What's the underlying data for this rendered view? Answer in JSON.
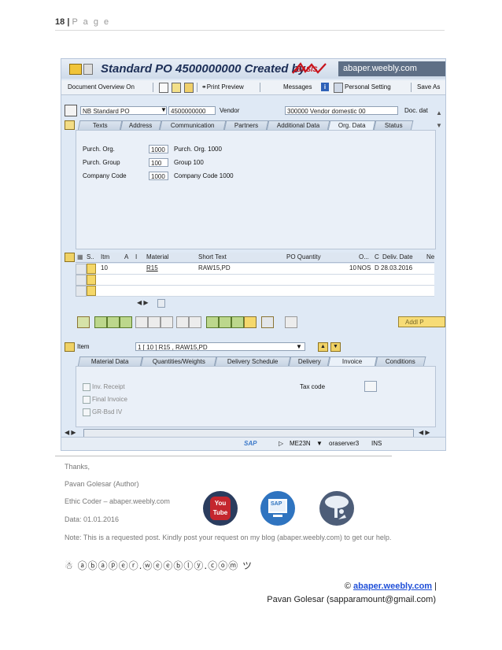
{
  "page_header": {
    "number": "18",
    "sep": "|",
    "page_word": "P a g e"
  },
  "sap": {
    "title": "Standard PO 4500000000 Created by",
    "stamp_text": "BASIS",
    "brand": "abaper.weebly.com",
    "toolbar": {
      "doc_overview": "Document Overview On",
      "print_preview": "Print Preview",
      "messages": "Messages",
      "personal_setting": "Personal Setting",
      "save_as": "Save As"
    },
    "header": {
      "doc_type": "NB Standard PO",
      "po_number": "4500000000",
      "vendor_label": "Vendor",
      "vendor_value": "300000 Vendor domestic 00",
      "doc_date_label": "Doc. dat"
    },
    "header_tabs": [
      "Texts",
      "Address",
      "Communication",
      "Partners",
      "Additional Data",
      "Org. Data",
      "Status"
    ],
    "org": [
      {
        "label": "Purch. Org.",
        "code": "1000",
        "desc": "Purch. Org. 1000"
      },
      {
        "label": "Purch. Group",
        "code": "100",
        "desc": "Group 100"
      },
      {
        "label": "Company Code",
        "code": "1000",
        "desc": "Company Code 1000"
      }
    ],
    "grid_headers": [
      "S..",
      "Itm",
      "A",
      "I",
      "Material",
      "Short Text",
      "PO Quantity",
      "O...",
      "C",
      "Deliv. Date",
      "Ne"
    ],
    "grid_row": {
      "itm": "10",
      "material": "R15",
      "short_text": "RAW15,PD",
      "qty": "10",
      "unit": "NOS",
      "c": "D",
      "deliv_date": "28.03.2016"
    },
    "addl_button": "Addl P",
    "item_label": "Item",
    "item_value": "1 [ 10 ] R15 , RAW15,PD",
    "item_tabs": [
      "Material Data",
      "Quantities/Weights",
      "Delivery Schedule",
      "Delivery",
      "Invoice",
      "Conditions"
    ],
    "invoice": {
      "inv_receipt": "Inv. Receipt",
      "final_invoice": "Final Invoice",
      "gr_bsd": "GR-Bsd IV",
      "tax_code": "Tax code"
    },
    "status": {
      "logo": "SAP",
      "tcode": "ME23N",
      "server": "oraserver3",
      "mode": "INS"
    }
  },
  "footer": {
    "thanks": "Thanks,",
    "author": "Pavan Golesar (Author)",
    "ethic": "Ethic Coder – abaper.weebly.com",
    "date": "Data: 01.01.2016",
    "note": "Note: This is a requested post. Kindly post your request on my blog (abaper.weebly.com) to get our help.",
    "fancy": "☃ ⓐⓑⓐⓟⓔⓡ.ⓦⓔⓔⓑⓛⓨ.ⓒⓞⓜ ツ",
    "youtube_top": "You",
    "youtube_bottom": "Tube",
    "sap_logo": "SAP",
    "copyright_symbol": "©",
    "copyright_link": "abaper.weebly.com",
    "copyright_pipe": "|",
    "email_line": "Pavan Golesar (sapparamount@gmail.com)"
  },
  "colors": {
    "sap_bg": "#dfe9f5",
    "link": "#1f4fd8",
    "youtube": "#c4262e",
    "sap_circle": "#2f74c0",
    "tree_circle": "#4d5d78"
  }
}
